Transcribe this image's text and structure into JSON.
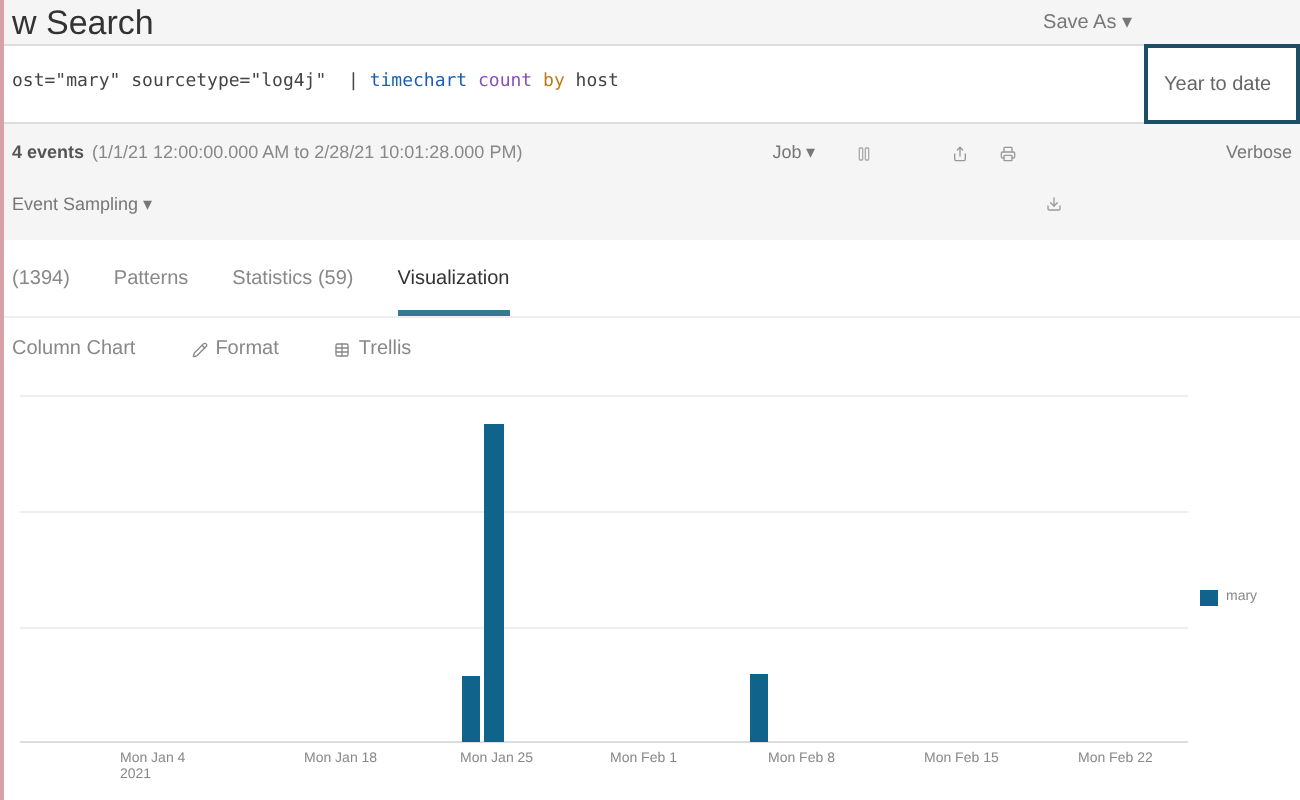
{
  "header": {
    "title": "w Search",
    "save_as": "Save As ▾"
  },
  "search": {
    "query_parts": [
      {
        "kind": "plain",
        "text": "ost=\"mary\" sourcetype=\"log4j\"  | "
      },
      {
        "kind": "command",
        "text": "timechart"
      },
      {
        "kind": "function",
        "text": " count"
      },
      {
        "kind": "keyword",
        "text": " by"
      },
      {
        "kind": "plain",
        "text": " host"
      }
    ],
    "time_range": "Year to date"
  },
  "summary": {
    "count": "4 events",
    "range": "(1/1/21 12:00:00.000 AM to 2/28/21 10:01:28.000 PM)",
    "job": "Job ▾",
    "mode": "Verbose",
    "sampling": "Event Sampling ▾"
  },
  "tabs": [
    {
      "label": "(1394)",
      "selected": false
    },
    {
      "label": "Patterns",
      "selected": false
    },
    {
      "label": "Statistics (59)",
      "selected": false
    },
    {
      "label": "Visualization",
      "selected": true
    }
  ],
  "viz_toolbar": {
    "chart_type": "Column Chart",
    "format": "Format",
    "trellis": "Trellis"
  },
  "chart": {
    "x_labels": [
      {
        "text": "Mon Jan 4",
        "sub": "2021"
      },
      {
        "text": "Mon Jan 18"
      },
      {
        "text": "Mon Jan 25"
      },
      {
        "text": "Mon Feb 1"
      },
      {
        "text": "Mon Feb 8"
      },
      {
        "text": "Mon Feb 15"
      },
      {
        "text": "Mon Feb 22"
      }
    ],
    "legend": [
      {
        "name": "mary",
        "color": "#10648c"
      }
    ]
  }
}
